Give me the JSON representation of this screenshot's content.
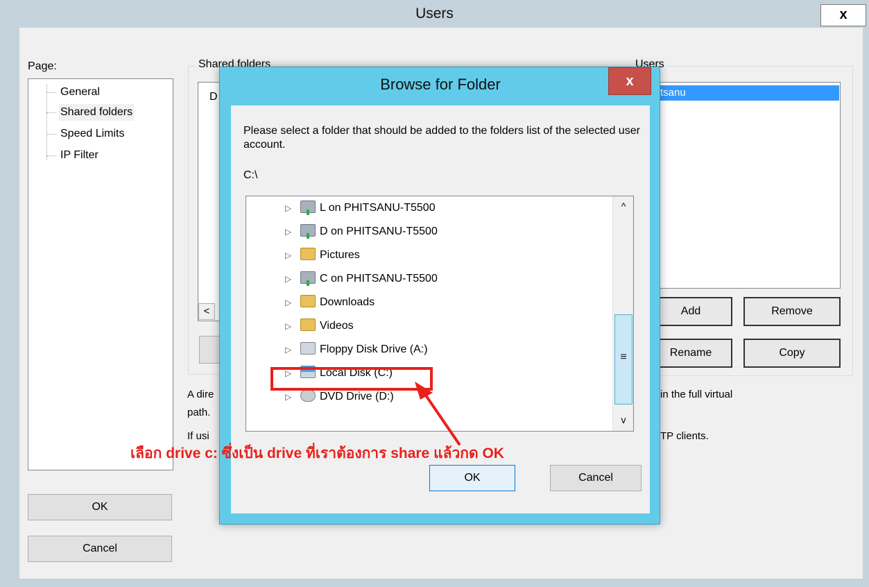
{
  "users_window": {
    "title": "Users",
    "close_glyph": "x",
    "page_label": "Page:",
    "pages": [
      "General",
      "Shared folders",
      "Speed Limits",
      "IP Filter"
    ],
    "selected_page": "Shared folders",
    "shared_folders_label": "Shared folders",
    "shared_folders_partial_header": "D",
    "shared_folders_scroll_glyph": "<",
    "users_label": "Users",
    "selected_user_partial": "tsanu",
    "add_button": "Add",
    "remove_button": "Remove",
    "rename_button": "Rename",
    "copy_button": "Copy",
    "info_line1_start": "A dire",
    "info_line1_end": "in the full virtual",
    "info_line2_start": "path.",
    "info_line3_start": "If usi",
    "info_line3_end": "TP clients.",
    "ok_button": "OK",
    "cancel_button": "Cancel"
  },
  "browse_dialog": {
    "title": "Browse for Folder",
    "close_glyph": "x",
    "description": "Please select a folder that should be added to the folders list of the selected user account.",
    "current_path": "C:\\",
    "folders": [
      {
        "label": "L on PHITSANU-T5500",
        "icon": "network-drive-icon"
      },
      {
        "label": "D on PHITSANU-T5500",
        "icon": "network-drive-icon"
      },
      {
        "label": "Pictures",
        "icon": "pictures-folder-icon"
      },
      {
        "label": "C on PHITSANU-T5500",
        "icon": "network-drive-icon"
      },
      {
        "label": "Downloads",
        "icon": "downloads-folder-icon"
      },
      {
        "label": "Videos",
        "icon": "videos-folder-icon"
      },
      {
        "label": "Floppy Disk Drive (A:)",
        "icon": "floppy-drive-icon"
      },
      {
        "label": "Local Disk (C:)",
        "icon": "local-disk-icon"
      },
      {
        "label": "DVD Drive (D:)",
        "icon": "dvd-drive-icon"
      }
    ],
    "expander_glyph": "▷",
    "scroll_up_glyph": "^",
    "scroll_down_glyph": "v",
    "scroll_grip_glyph": "≡",
    "ok_button": "OK",
    "cancel_button": "Cancel"
  },
  "annotation": {
    "text": "เลือก drive c: ซึ่งเป็น drive ที่เราต้องการ share แล้วกด OK",
    "color": "#e8211d"
  },
  "colors": {
    "dialog_frame": "#62cbea",
    "close_button": "#c7504a",
    "window_title_bar": "#c4d3dc"
  }
}
